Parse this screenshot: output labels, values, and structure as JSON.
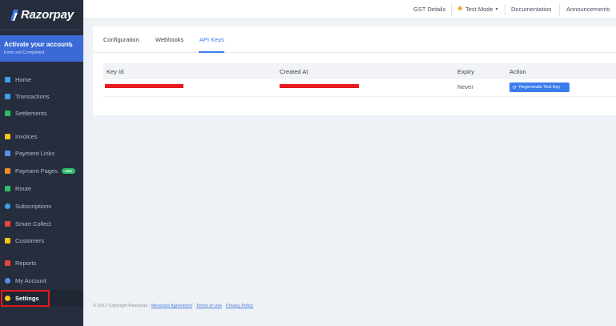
{
  "brand": {
    "name": "Razorpay"
  },
  "activate": {
    "title": "Activate your account",
    "subtitle": "Form not Completed",
    "arrow": "›"
  },
  "sidebar": {
    "items": [
      {
        "label": "Home",
        "icon": "home-icon",
        "color": "#3aa0e8"
      },
      {
        "label": "Transactions",
        "icon": "transactions-icon",
        "color": "#3aa0e8"
      },
      {
        "label": "Settlements",
        "icon": "settlements-icon",
        "color": "#2ebd6b"
      },
      {
        "label": "Invoices",
        "icon": "invoices-icon",
        "color": "#f5c518"
      },
      {
        "label": "Payment Links",
        "icon": "payment-links-icon",
        "color": "#5b8ef0"
      },
      {
        "label": "Payment Pages",
        "icon": "payment-pages-icon",
        "color": "#f08a24",
        "badge": "new"
      },
      {
        "label": "Route",
        "icon": "route-icon",
        "color": "#2ebd6b"
      },
      {
        "label": "Subscriptions",
        "icon": "subscriptions-icon",
        "color": "#3aa0e8"
      },
      {
        "label": "Smart Collect",
        "icon": "smart-collect-icon",
        "color": "#e8453c"
      },
      {
        "label": "Customers",
        "icon": "customers-icon",
        "color": "#f5c518"
      },
      {
        "label": "Reports",
        "icon": "reports-icon",
        "color": "#e8453c"
      },
      {
        "label": "My Account",
        "icon": "account-icon",
        "color": "#5b8ef0"
      },
      {
        "label": "Settings",
        "icon": "gear-icon",
        "color": "#f5c518",
        "active": true
      }
    ]
  },
  "topbar": {
    "gst": "GST Details",
    "mode": "Test Mode",
    "docs": "Documentation",
    "announcements": "Announcements"
  },
  "tabs": [
    {
      "label": "Configuration"
    },
    {
      "label": "Webhooks"
    },
    {
      "label": "API Keys",
      "active": true
    }
  ],
  "table": {
    "headers": [
      "Key Id",
      "Created At",
      "Expiry",
      "Action"
    ],
    "rows": [
      {
        "key_id": "",
        "created_at": "",
        "expiry": "Never",
        "action": "Regenerate Test Key"
      }
    ]
  },
  "footer": {
    "copyright": "© 2017 Copyright Razorpay ·",
    "merchant_agreement": "Merchant Agreement",
    "terms": "Terms of Use",
    "privacy": "Privacy Policy",
    "sep": "·"
  },
  "colors": {
    "sidebar": "#262e3d",
    "accent": "#3b7ded",
    "activate": "#3b6ad6",
    "redaction": "#e61b1b",
    "highlight": "#e0191f"
  }
}
